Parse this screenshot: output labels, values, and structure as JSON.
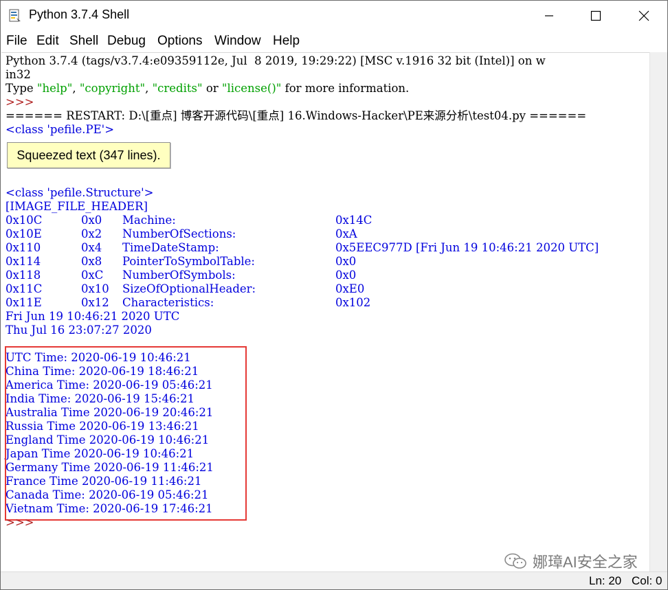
{
  "window": {
    "title": "Python 3.7.4 Shell",
    "controls": {
      "minimize": "minimize-icon",
      "maximize": "maximize-icon",
      "close": "close-icon"
    }
  },
  "menu": [
    "File",
    "Edit",
    "Shell",
    "Debug",
    "Options",
    "Window",
    "Help"
  ],
  "shell": {
    "banner1": "Python 3.7.4 (tags/v3.7.4:e09359112e, Jul  8 2019, 19:29:22) [MSC v.1916 32 bit (Intel)] on w",
    "banner2": "in32",
    "help_prefix": "Type ",
    "help_s1": "\"help\"",
    "help_c1": ", ",
    "help_s2": "\"copyright\"",
    "help_c2": ", ",
    "help_s3": "\"credits\"",
    "help_or": " or ",
    "help_s4": "\"license()\"",
    "help_suffix": " for more information.",
    "prompt": ">>>",
    "restart": "====== RESTART: D:\\[重点] 博客开源代码\\[重点] 16.Windows-Hacker\\PE来源分析\\test04.py ======",
    "class_pe": "<class 'pefile.PE'>",
    "squeezed": "Squeezed text (347 lines).",
    "class_structure": "<class 'pefile.Structure'>",
    "section_header": "[IMAGE_FILE_HEADER]",
    "header_rows": [
      {
        "addr": "0x10C",
        "offset": "0x0",
        "field": "Machine:",
        "value": "0x14C"
      },
      {
        "addr": "0x10E",
        "offset": "0x2",
        "field": "NumberOfSections:",
        "value": "0xA"
      },
      {
        "addr": "0x110",
        "offset": "0x4",
        "field": "TimeDateStamp:",
        "value": "0x5EEC977D [Fri Jun 19 10:46:21 2020 UTC]"
      },
      {
        "addr": "0x114",
        "offset": "0x8",
        "field": "PointerToSymbolTable:",
        "value": "0x0"
      },
      {
        "addr": "0x118",
        "offset": "0xC",
        "field": "NumberOfSymbols:",
        "value": "0x0"
      },
      {
        "addr": "0x11C",
        "offset": "0x10",
        "field": "SizeOfOptionalHeader:",
        "value": "0xE0"
      },
      {
        "addr": "0x11E",
        "offset": "0x12",
        "field": "Characteristics:",
        "value": "0x102"
      }
    ],
    "date_line1": "Fri Jun 19 10:46:21 2020 UTC",
    "date_line2": "Thu Jul 16 23:07:27 2020",
    "time_lines": [
      "UTC Time: 2020-06-19 10:46:21",
      "China Time: 2020-06-19 18:46:21",
      "America Time: 2020-06-19 05:46:21",
      "India Time: 2020-06-19 15:46:21",
      "Australia Time 2020-06-19 20:46:21",
      "Russia Time 2020-06-19 13:46:21",
      "England Time 2020-06-19 10:46:21",
      "Japan Time 2020-06-19 10:46:21",
      "Germany Time 2020-06-19 11:46:21",
      "France Time 2020-06-19 11:46:21",
      "Canada Time: 2020-06-19 05:46:21",
      "Vietnam Time: 2020-06-19 17:46:21"
    ]
  },
  "status": {
    "line": "Ln: 20",
    "col": "Col: 0"
  },
  "watermark": "娜璋AI安全之家",
  "colors": {
    "output_blue": "#0000dd",
    "string_green": "#00a000",
    "prompt_red": "#b02020",
    "squeezed_bg": "#ffffc0",
    "highlight_red": "#e53935"
  }
}
